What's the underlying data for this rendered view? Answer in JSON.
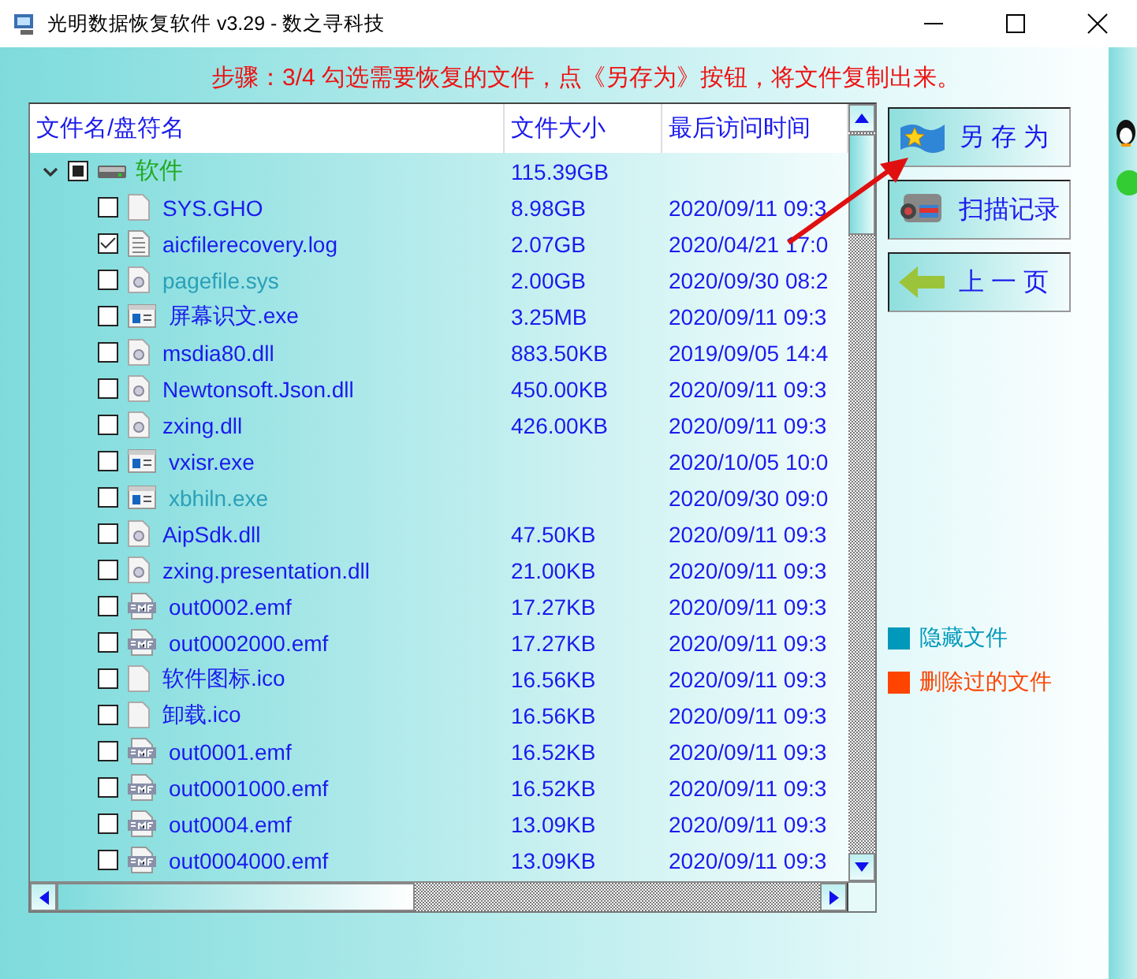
{
  "window": {
    "title": "光明数据恢复软件 v3.29 - 数之寻科技"
  },
  "step_text": "步骤：3/4 勾选需要恢复的文件，点《另存为》按钮，将文件复制出来。",
  "table": {
    "columns": [
      "文件名/盘符名",
      "文件大小",
      "最后访问时间"
    ],
    "root": {
      "name": "软件",
      "size": "115.39GB",
      "expanded": true,
      "checked": true,
      "children": [
        {
          "name": "SYS.GHO",
          "size": "8.98GB",
          "date": "2020/09/11 09:3",
          "checked": false,
          "kind": "blank",
          "hidden": false
        },
        {
          "name": "aicfilerecovery.log",
          "size": "2.07GB",
          "date": "2020/04/21 17:0",
          "checked": true,
          "kind": "text",
          "hidden": false
        },
        {
          "name": "pagefile.sys",
          "size": "2.00GB",
          "date": "2020/09/30 08:2",
          "checked": false,
          "kind": "dll",
          "hidden": true
        },
        {
          "name": "屏幕识文.exe",
          "size": "3.25MB",
          "date": "2020/09/11 09:3",
          "checked": false,
          "kind": "exe",
          "hidden": false
        },
        {
          "name": "msdia80.dll",
          "size": "883.50KB",
          "date": "2019/09/05 14:4",
          "checked": false,
          "kind": "dll",
          "hidden": false
        },
        {
          "name": "Newtonsoft.Json.dll",
          "size": "450.00KB",
          "date": "2020/09/11 09:3",
          "checked": false,
          "kind": "dll",
          "hidden": false
        },
        {
          "name": "zxing.dll",
          "size": "426.00KB",
          "date": "2020/09/11 09:3",
          "checked": false,
          "kind": "dll",
          "hidden": false
        },
        {
          "name": "vxisr.exe",
          "date": "2020/10/05 10:0",
          "checked": false,
          "kind": "exe",
          "hidden": false
        },
        {
          "name": "xbhiln.exe",
          "date": "2020/09/30 09:0",
          "checked": false,
          "kind": "exe",
          "hidden": true
        },
        {
          "name": "AipSdk.dll",
          "size": "47.50KB",
          "date": "2020/09/11 09:3",
          "checked": false,
          "kind": "dll",
          "hidden": false
        },
        {
          "name": "zxing.presentation.dll",
          "size": "21.00KB",
          "date": "2020/09/11 09:3",
          "checked": false,
          "kind": "dll",
          "hidden": false
        },
        {
          "name": "out0002.emf",
          "size": "17.27KB",
          "date": "2020/09/11 09:3",
          "checked": false,
          "kind": "emf",
          "hidden": false
        },
        {
          "name": "out0002000.emf",
          "size": "17.27KB",
          "date": "2020/09/11 09:3",
          "checked": false,
          "kind": "emf",
          "hidden": false
        },
        {
          "name": "软件图标.ico",
          "size": "16.56KB",
          "date": "2020/09/11 09:3",
          "checked": false,
          "kind": "blank",
          "hidden": false
        },
        {
          "name": "卸载.ico",
          "size": "16.56KB",
          "date": "2020/09/11 09:3",
          "checked": false,
          "kind": "blank",
          "hidden": false
        },
        {
          "name": "out0001.emf",
          "size": "16.52KB",
          "date": "2020/09/11 09:3",
          "checked": false,
          "kind": "emf",
          "hidden": false
        },
        {
          "name": "out0001000.emf",
          "size": "16.52KB",
          "date": "2020/09/11 09:3",
          "checked": false,
          "kind": "emf",
          "hidden": false
        },
        {
          "name": "out0004.emf",
          "size": "13.09KB",
          "date": "2020/09/11 09:3",
          "checked": false,
          "kind": "emf",
          "hidden": false
        },
        {
          "name": "out0004000.emf",
          "size": "13.09KB",
          "date": "2020/09/11 09:3",
          "checked": false,
          "kind": "emf",
          "hidden": false
        }
      ]
    }
  },
  "buttons": [
    {
      "label": "另 存 为"
    },
    {
      "label": "扫描记录"
    },
    {
      "label": "上 一 页"
    }
  ],
  "legend": [
    {
      "label": "隐藏文件",
      "color": "#0099bb"
    },
    {
      "label": "删除过的文件",
      "color": "#ff4400"
    }
  ]
}
